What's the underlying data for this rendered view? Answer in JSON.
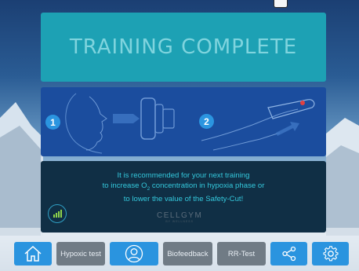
{
  "screen": {
    "title": "TRAINING COMPLETE",
    "steps": [
      "1",
      "2"
    ],
    "message": {
      "line1": "It is recommended for your next training",
      "line2_prefix": "to increase O",
      "line2_sub": "2",
      "line2_suffix": " concentration in hypoxia phase or",
      "line3": "to lower the value of the Safety-Cut!"
    },
    "logo": {
      "name": "CELLGYM",
      "tagline": "BY WELLNESS"
    }
  },
  "toolbar": {
    "home_icon": "home-icon",
    "hypoxic_label": "Hypoxic test",
    "profile_icon": "user-icon",
    "biofeedback_label": "Biofeedback",
    "rr_label": "RR-Test",
    "share_icon": "share-icon",
    "settings_icon": "gear-icon"
  },
  "colors": {
    "title_panel": "#1da1b4",
    "instruction_panel": "#1b4d9e",
    "message_panel": "#102f45",
    "accent_blue": "#2a94df",
    "button_grey": "#707b85",
    "message_text": "#34c8dc"
  }
}
